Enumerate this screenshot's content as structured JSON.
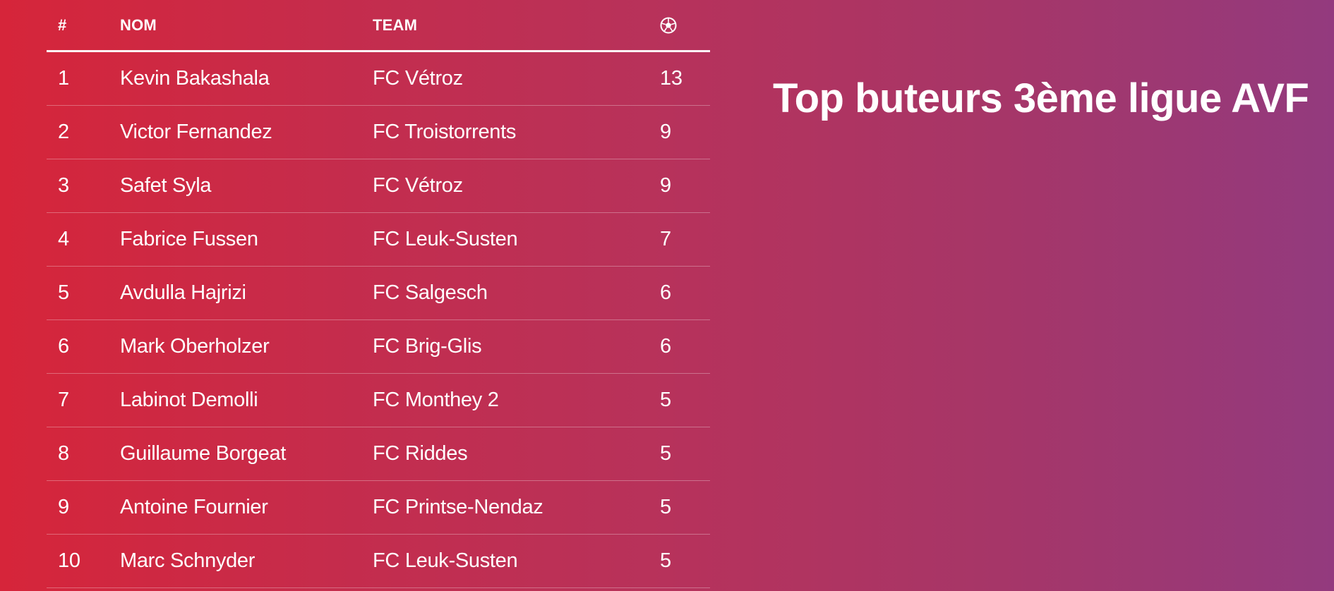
{
  "title": "Top buteurs 3ème ligue AVF",
  "table": {
    "headers": {
      "rank": "#",
      "name": "NOM",
      "team": "TEAM",
      "goals_icon": "soccer-ball-icon"
    },
    "rows": [
      {
        "rank": "1",
        "name": "Kevin Bakashala",
        "team": "FC Vétroz",
        "goals": "13"
      },
      {
        "rank": "2",
        "name": "Victor Fernandez",
        "team": "FC Troistorrents",
        "goals": "9"
      },
      {
        "rank": "3",
        "name": "Safet Syla",
        "team": "FC Vétroz",
        "goals": "9"
      },
      {
        "rank": "4",
        "name": "Fabrice Fussen",
        "team": "FC Leuk-Susten",
        "goals": "7"
      },
      {
        "rank": "5",
        "name": "Avdulla Hajrizi",
        "team": "FC Salgesch",
        "goals": "6"
      },
      {
        "rank": "6",
        "name": "Mark Oberholzer",
        "team": "FC Brig-Glis",
        "goals": "6"
      },
      {
        "rank": "7",
        "name": "Labinot Demolli",
        "team": "FC Monthey 2",
        "goals": "5"
      },
      {
        "rank": "8",
        "name": "Guillaume Borgeat",
        "team": "FC Riddes",
        "goals": "5"
      },
      {
        "rank": "9",
        "name": "Antoine Fournier",
        "team": "FC Printse-Nendaz",
        "goals": "5"
      },
      {
        "rank": "10",
        "name": "Marc Schnyder",
        "team": "FC Leuk-Susten",
        "goals": "5"
      }
    ]
  },
  "colors": {
    "gradient_start": "#d6253a",
    "gradient_end": "#933a7e",
    "text": "#ffffff"
  }
}
